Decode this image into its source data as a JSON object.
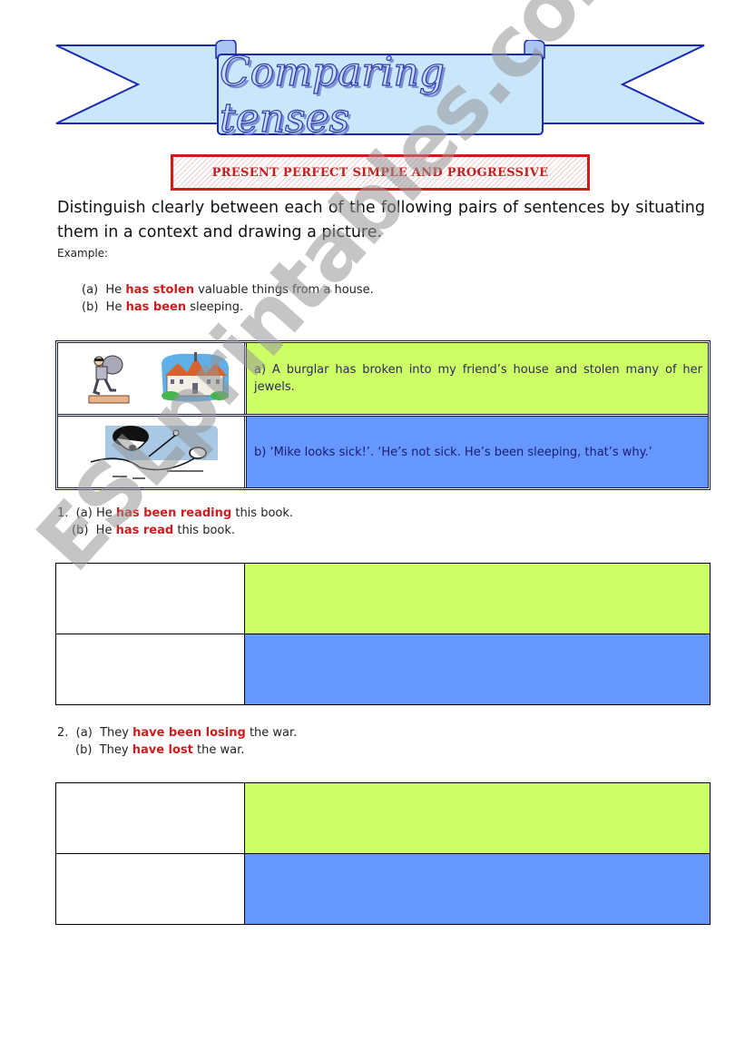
{
  "header": {
    "title": "Comparing tenses",
    "subtitle": "PRESENT PERFECT SIMPLE AND PROGRESSIVE"
  },
  "instructions": {
    "text": "Distinguish clearly between each of the following pairs of sentences by situating them in a context and drawing a picture.",
    "example_label": "Example:"
  },
  "example": {
    "sentences": [
      {
        "label": "(a)",
        "before": "He",
        "highlight": "has stolen",
        "after": "valuable things from a house."
      },
      {
        "label": "(b)",
        "before": "He",
        "highlight": "has been",
        "after": "sleeping."
      }
    ],
    "rows": [
      {
        "picture": "burglar-and-house-clipart",
        "answer": "a)  A burglar has broken into my friend’s house and stolen many of her jewels."
      },
      {
        "picture": "sleepy-boy-clipart",
        "answer": "b)  ‘Mike looks sick!’.  ‘He’s not sick.  He’s been sleeping, that’s why.’"
      }
    ]
  },
  "exercises": [
    {
      "number": "1.",
      "sentences": [
        {
          "label": "(a)",
          "before": "He",
          "highlight": "has been reading",
          "after": "this book."
        },
        {
          "label": "(b)",
          "before": "He",
          "highlight": "has read",
          "after": "this book."
        }
      ]
    },
    {
      "number": "2.",
      "sentences": [
        {
          "label": "(a)",
          "before": "They",
          "highlight": "have been losing",
          "after": "the war."
        },
        {
          "label": "(b)",
          "before": "They",
          "highlight": "have lost",
          "after": "the war."
        }
      ]
    }
  ],
  "colors": {
    "row_a": "#cefe66",
    "row_b": "#6597fe",
    "highlight": "#d01c1c",
    "subtitle_border": "#d21a1a",
    "banner_fill": "#c9e6fb",
    "banner_stroke": "#1a2ab0"
  },
  "watermark": "ESLprintables.com"
}
